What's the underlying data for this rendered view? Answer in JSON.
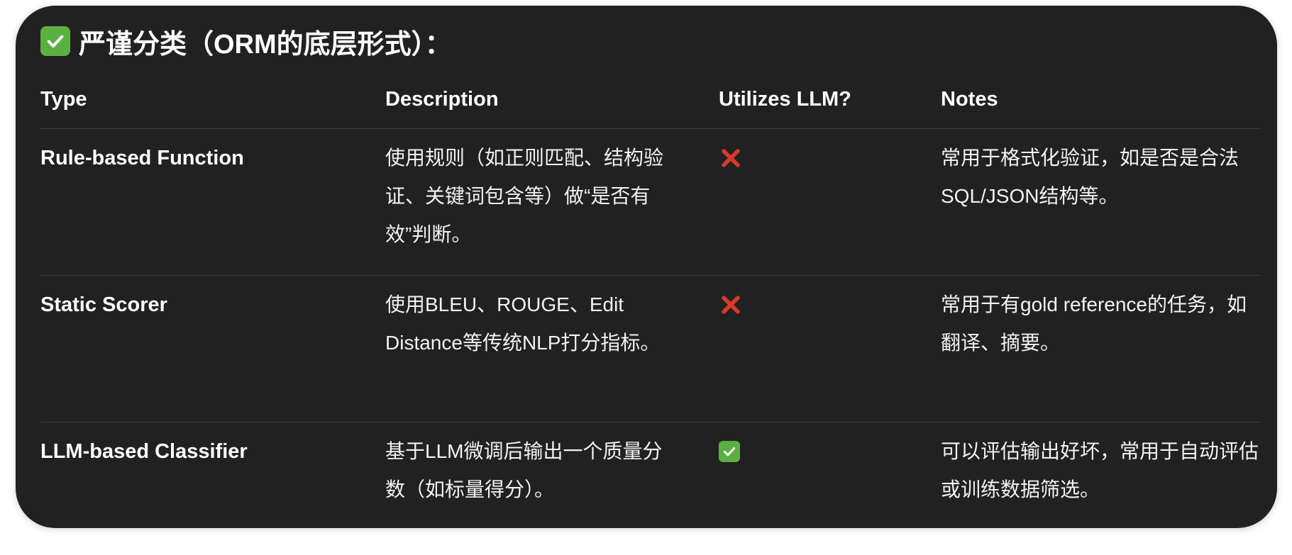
{
  "title": "严谨分类（ORM的底层形式）：",
  "title_icon": "check-mark-button-icon",
  "colors": {
    "card_background": "#212121",
    "check_green": "#5bb041",
    "cross_red": "#d93a2b"
  },
  "table": {
    "headers": [
      "Type",
      "Description",
      "Utilizes LLM?",
      "Notes"
    ],
    "rows": [
      {
        "type": "Rule-based Function",
        "description": "使用规则（如正则匹配、结构验证、关键词包含等）做“是否有效”判断。",
        "utilizes_llm": "cross-mark-icon",
        "notes": "常用于格式化验证，如是否是合法SQL/JSON结构等。"
      },
      {
        "type": "Static Scorer",
        "description": "使用BLEU、ROUGE、Edit Distance等传统NLP打分指标。",
        "utilizes_llm": "cross-mark-icon",
        "notes": "常用于有gold reference的任务，如翻译、摘要。"
      },
      {
        "type": "LLM-based Classifier",
        "description": "基于LLM微调后输出一个质量分数（如标量得分）。",
        "utilizes_llm": "check-mark-button-icon",
        "notes": "可以评估输出好坏，常用于自动评估或训练数据筛选。"
      }
    ]
  }
}
